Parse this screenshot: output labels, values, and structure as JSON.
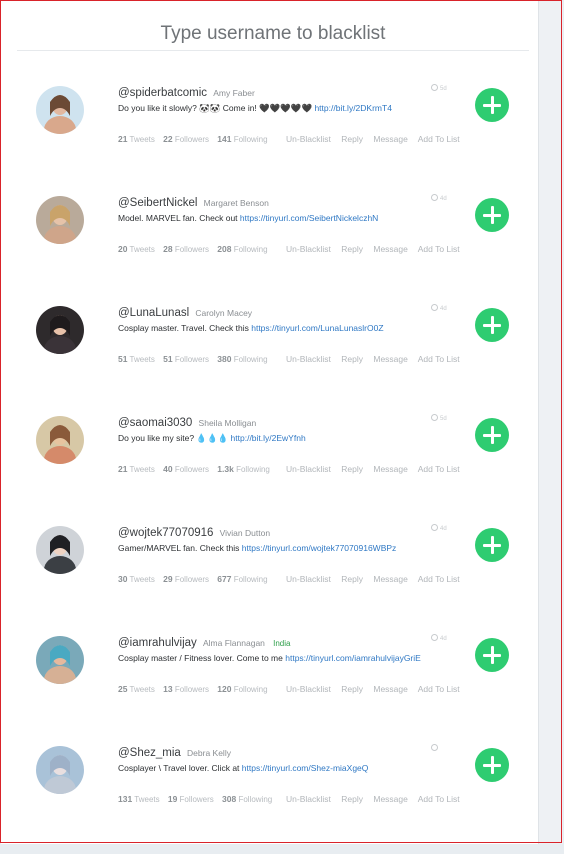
{
  "header": {
    "title": "Type username to blacklist"
  },
  "labels": {
    "tweets": "Tweets",
    "followers": "Followers",
    "following": "Following"
  },
  "actions": {
    "unblacklist": "Un-Blacklist",
    "reply": "Reply",
    "message": "Message",
    "add_to_list": "Add To List"
  },
  "icons": {
    "add": "plus-circle-icon",
    "time": "clock-icon"
  },
  "colors": {
    "add_button": "#2ecc71",
    "link": "#2f78c4",
    "country": "#2e9e4a"
  },
  "users": [
    {
      "handle": "@spiderbatcomic",
      "name": "Amy Faber",
      "country": "",
      "bio": "Do you like it slowly? 🐼🐼 Come in! 🖤🖤🖤🖤🖤",
      "link": "http://bit.ly/2DKrmT4",
      "tweets": "21",
      "followers": "22",
      "following": "141",
      "time": "5d"
    },
    {
      "handle": "@SeibertNickel",
      "name": "Margaret Benson",
      "country": "",
      "bio": "Model. MARVEL fan. Check out",
      "link": "https://tinyurl.com/SeibertNickelczhN",
      "tweets": "20",
      "followers": "28",
      "following": "208",
      "time": "4d"
    },
    {
      "handle": "@LunaLunasl",
      "name": "Carolyn Macey",
      "country": "",
      "bio": "Cosplay master. Travel. Check this",
      "link": "https://tinyurl.com/LunaLunaslrO0Z",
      "tweets": "51",
      "followers": "51",
      "following": "380",
      "time": "4d"
    },
    {
      "handle": "@saomai3030",
      "name": "Sheila Molligan",
      "country": "",
      "bio": "Do you like my site? 💧💧💧",
      "link": "http://bit.ly/2EwYfnh",
      "tweets": "21",
      "followers": "40",
      "following": "1.3k",
      "time": "5d"
    },
    {
      "handle": "@wojtek77070916",
      "name": "Vivian Dutton",
      "country": "",
      "bio": "Gamer/MARVEL fan. Check this",
      "link": "https://tinyurl.com/wojtek77070916WBPz",
      "tweets": "30",
      "followers": "29",
      "following": "677",
      "time": "4d"
    },
    {
      "handle": "@iamrahulvijay",
      "name": "Alma Flannagan",
      "country": "India",
      "bio": "Cosplay master / Fitness lover. Come to me",
      "link": "https://tinyurl.com/iamrahulvijayGriE",
      "tweets": "25",
      "followers": "13",
      "following": "120",
      "time": "4d"
    },
    {
      "handle": "@Shez_mia",
      "name": "Debra Kelly",
      "country": "",
      "bio": "Cosplayer \\ Travel lover. Click at",
      "link": "https://tinyurl.com/Shez-miaXgeQ",
      "tweets": "131",
      "followers": "19",
      "following": "308",
      "time": ""
    }
  ]
}
